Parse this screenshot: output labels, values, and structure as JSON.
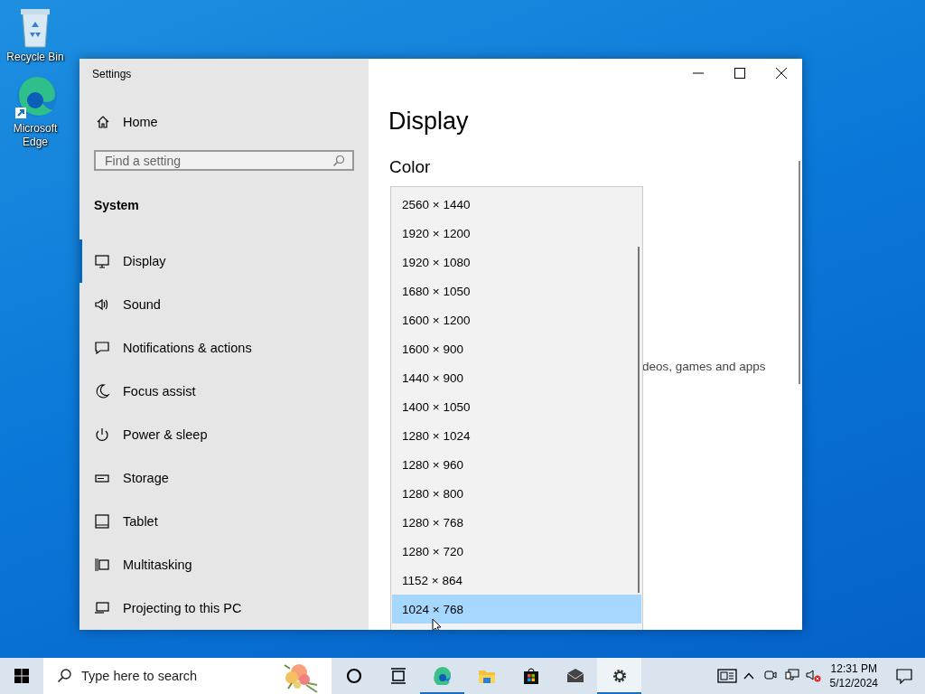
{
  "desktop_icons": [
    {
      "label": "Recycle Bin"
    },
    {
      "label": "Microsoft Edge"
    }
  ],
  "window": {
    "title": "Settings",
    "sidebar": {
      "home": "Home",
      "search": {
        "placeholder": "Find a setting"
      },
      "section": "System",
      "items": [
        {
          "label": "Display",
          "selected": true
        },
        {
          "label": "Sound",
          "selected": false
        },
        {
          "label": "Notifications & actions",
          "selected": false
        },
        {
          "label": "Focus assist",
          "selected": false
        },
        {
          "label": "Power & sleep",
          "selected": false
        },
        {
          "label": "Storage",
          "selected": false
        },
        {
          "label": "Tablet",
          "selected": false
        },
        {
          "label": "Multitasking",
          "selected": false
        },
        {
          "label": "Projecting to this PC",
          "selected": false
        }
      ]
    },
    "page": {
      "title": "Display",
      "section": "Color",
      "partial_text": "deos, games and apps",
      "dropdown": [
        {
          "label": "2560 × 1440",
          "selected": false
        },
        {
          "label": "1920 × 1200",
          "selected": false
        },
        {
          "label": "1920 × 1080",
          "selected": false
        },
        {
          "label": "1680 × 1050",
          "selected": false
        },
        {
          "label": "1600 × 1200",
          "selected": false
        },
        {
          "label": "1600 × 900",
          "selected": false
        },
        {
          "label": "1440 × 900",
          "selected": false
        },
        {
          "label": "1400 × 1050",
          "selected": false
        },
        {
          "label": "1280 × 1024",
          "selected": false
        },
        {
          "label": "1280 × 960",
          "selected": false
        },
        {
          "label": "1280 × 800",
          "selected": false
        },
        {
          "label": "1280 × 768",
          "selected": false
        },
        {
          "label": "1280 × 720",
          "selected": false
        },
        {
          "label": "1152 × 864",
          "selected": false
        },
        {
          "label": "1024 × 768",
          "selected": true
        }
      ]
    }
  },
  "taskbar": {
    "search": {
      "placeholder": "Type here to search"
    },
    "apps": [
      {
        "running": false,
        "active": false
      },
      {
        "running": false,
        "active": false
      },
      {
        "running": true,
        "active": false
      },
      {
        "running": false,
        "active": false
      },
      {
        "running": false,
        "active": false
      },
      {
        "running": false,
        "active": false
      },
      {
        "running": true,
        "active": true
      }
    ],
    "time": "12:31 PM",
    "date": "5/12/2024"
  }
}
